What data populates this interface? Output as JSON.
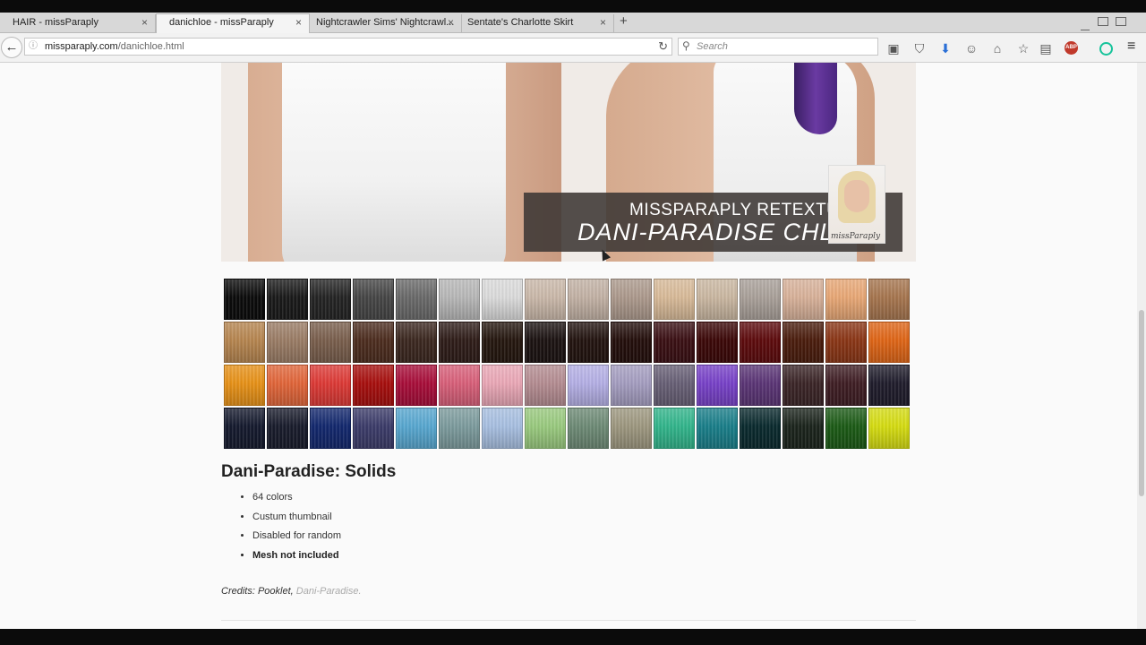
{
  "browser": {
    "tabs": [
      {
        "label": "HAIR - missParaply"
      },
      {
        "label": "danichloe - missParaply"
      },
      {
        "label": "Nightcrawler Sims' Nightcrawl..."
      },
      {
        "label": "Sentate's Charlotte Skirt"
      }
    ],
    "active_tab_index": 1,
    "url_domain": "missparaply.com",
    "url_path": "/danichloe.html",
    "search_placeholder": "Search"
  },
  "banner": {
    "line1": "MISSPARAPLY RETEXTURE",
    "line2": "DANI-PARADISE CHLOE",
    "signature": "missParaply"
  },
  "swatches": [
    "#0b0b0b",
    "#1a1a1a",
    "#242424",
    "#464646",
    "#6a6a6a",
    "#b8b8b8",
    "#dcdcdc",
    "#cbb9aa",
    "#c3b2a5",
    "#ad9a8d",
    "#d9bb99",
    "#cbb8a2",
    "#aaa19a",
    "#d9b29a",
    "#e9a876",
    "#a7764f",
    "#b78650",
    "#9b7d66",
    "#7a5f4d",
    "#4d2d1f",
    "#3c2820",
    "#2f1d19",
    "#25170f",
    "#1c1312",
    "#231410",
    "#240f0c",
    "#3b1014",
    "#3c0808",
    "#5e0b0d",
    "#4b1d0d",
    "#8b3616",
    "#e06617",
    "#e89218",
    "#e2663a",
    "#de3a36",
    "#a80f0e",
    "#a90e3a",
    "#d9607a",
    "#eba8b7",
    "#b58d92",
    "#b5b0e6",
    "#a59ec1",
    "#686076",
    "#7842c9",
    "#5b3576",
    "#3b2527",
    "#3f1e24",
    "#201d2c",
    "#151a2e",
    "#191c2c",
    "#13286e",
    "#3c3c6a",
    "#58a8d1",
    "#7d9c9e",
    "#a8c0e2",
    "#9acb7f",
    "#6e8b76",
    "#9e9880",
    "#32b68c",
    "#1a7f8a",
    "#0a2a2e",
    "#1b241c",
    "#1c5b16",
    "#d6dd12"
  ],
  "product": {
    "heading": "Dani-Paradise: Solids",
    "bullets": [
      {
        "text": "64 colors",
        "bold": false
      },
      {
        "text": "Custum thumbnail",
        "bold": false
      },
      {
        "text": "Disabled for random",
        "bold": false
      },
      {
        "text": "Mesh not included",
        "bold": true
      }
    ],
    "credits_prefix": "Credits: Pooklet, ",
    "credits_link": "Dani-Paradise."
  }
}
